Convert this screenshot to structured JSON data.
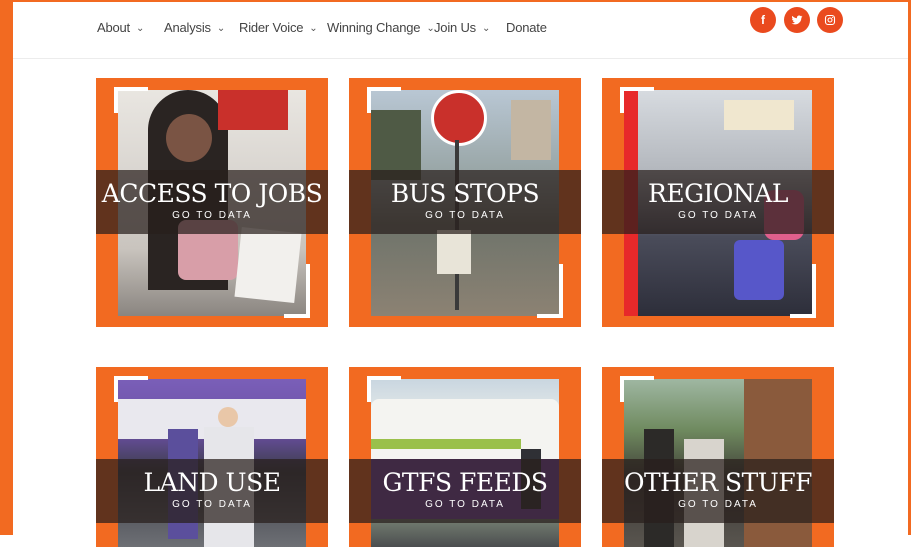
{
  "nav": {
    "items": [
      {
        "label": "About",
        "has_dropdown": true
      },
      {
        "label": "Analysis",
        "has_dropdown": true
      },
      {
        "label": "Rider Voice",
        "has_dropdown": true
      },
      {
        "label": "Winning Change",
        "has_dropdown": true
      },
      {
        "label": "Join Us",
        "has_dropdown": true
      },
      {
        "label": "Donate",
        "has_dropdown": false
      }
    ],
    "social": [
      {
        "icon": "facebook-icon",
        "glyph": "f"
      },
      {
        "icon": "twitter-icon",
        "glyph": "🐦"
      },
      {
        "icon": "instagram-icon",
        "glyph": "◎"
      }
    ]
  },
  "cards": [
    {
      "title": "ACCESS TO JOBS",
      "link": "GO TO DATA"
    },
    {
      "title": "BUS STOPS",
      "link": "GO TO DATA"
    },
    {
      "title": "REGIONAL",
      "link": "GO TO DATA"
    },
    {
      "title": "LAND USE",
      "link": "GO TO DATA"
    },
    {
      "title": "GTFS FEEDS",
      "link": "GO TO DATA"
    },
    {
      "title": "OTHER STUFF",
      "link": "GO TO DATA"
    }
  ],
  "colors": {
    "brand_orange": "#f26a21",
    "social_red": "#ea4a1e",
    "band_overlay": "rgba(40,30,28,0.72)"
  }
}
